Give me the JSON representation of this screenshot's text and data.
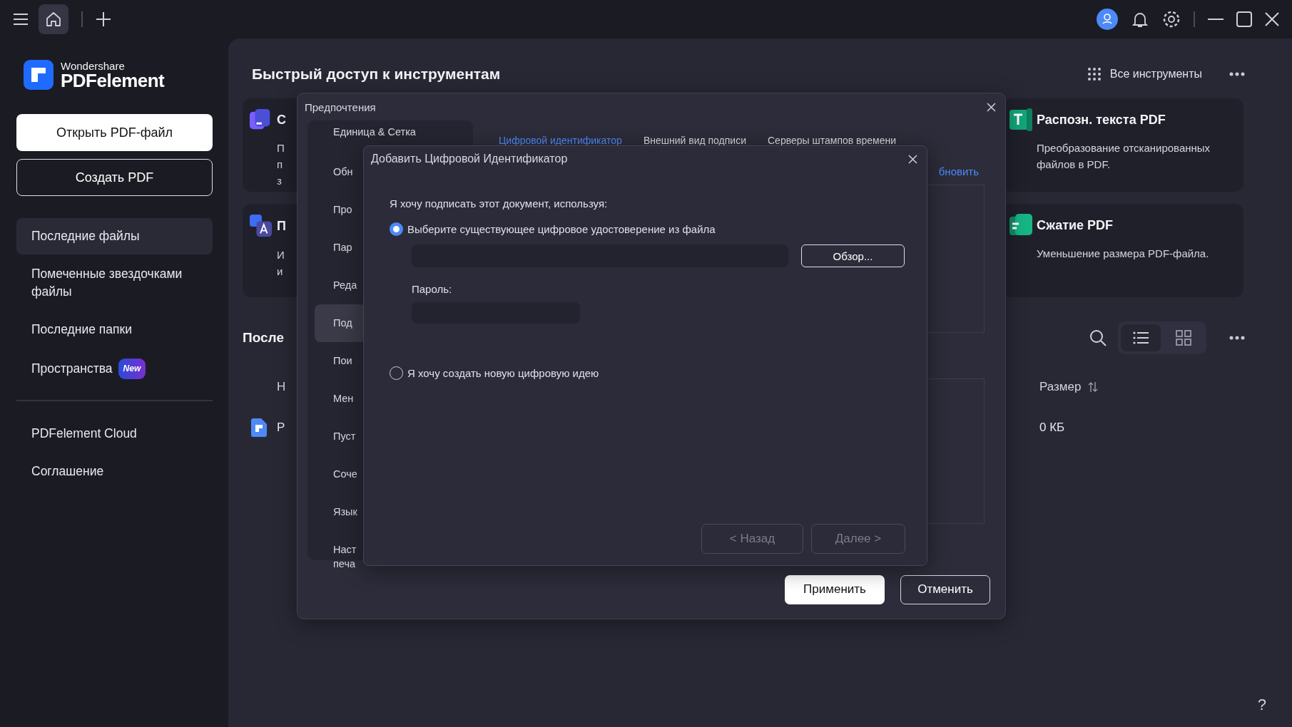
{
  "brand": {
    "vendor": "Wondershare",
    "product": "PDFelement"
  },
  "sidebar": {
    "buttons": [
      {
        "label": "Открыть PDF-файл",
        "kind": "primary"
      },
      {
        "label": "Создать PDF",
        "kind": "outline"
      }
    ],
    "items": [
      {
        "label": "Последние файлы",
        "selected": true
      },
      {
        "label": "Помеченные звездочками файлы",
        "selected": false
      },
      {
        "label": "Последние папки",
        "selected": false
      },
      {
        "label": "Пространства",
        "selected": false,
        "badge": "New"
      }
    ],
    "footer_items": [
      "PDFelement Cloud",
      "Соглашение"
    ]
  },
  "quick_tools": {
    "title": "Быстрый доступ к инструментам",
    "all_tools": "Все инструменты",
    "cards": [
      {
        "kind": "pen",
        "title": "С",
        "description_lines": [
          "П",
          "п",
          "з"
        ]
      },
      {
        "kind": "ocr",
        "title": "Распозн. текста PDF",
        "description_lines": [
          "Преобразование отсканированных",
          "файлов в PDF."
        ]
      },
      {
        "kind": "translate",
        "title": "П",
        "description_lines": [
          "И",
          "и"
        ]
      },
      {
        "kind": "compress",
        "title": "Сжатие PDF",
        "description_lines": [
          "Уменьшение размера PDF-файла."
        ]
      }
    ]
  },
  "recent": {
    "title": "После",
    "columns": [
      "Н",
      "Размер"
    ],
    "rows": [
      {
        "name": "Р",
        "size": "0 КБ"
      }
    ]
  },
  "view_modes": [
    {
      "kind": "list",
      "selected": true
    },
    {
      "kind": "grid",
      "selected": false
    }
  ],
  "help_button": "?",
  "preferences": {
    "title": "Предпочтения",
    "nav": [
      {
        "label": "Единица & Сетка",
        "selected": false
      },
      {
        "label": "Обн",
        "selected": false
      },
      {
        "label": "Про",
        "selected": false
      },
      {
        "label": "Пар",
        "selected": false
      },
      {
        "label": "Реда",
        "selected": false
      },
      {
        "label": "Под",
        "selected": true
      },
      {
        "label": "Пои",
        "selected": false
      },
      {
        "label": "Мен",
        "selected": false
      },
      {
        "label": "Пуст",
        "selected": false
      },
      {
        "label": "Соче",
        "selected": false
      },
      {
        "label": "Язык",
        "selected": false
      },
      {
        "label": "Наст печа",
        "selected": false
      }
    ],
    "tabs": [
      {
        "label": "Цифровой идентификатор",
        "selected": true
      },
      {
        "label": "Внешний вид подписи",
        "selected": false
      },
      {
        "label": "Серверы штампов времени",
        "selected": false
      }
    ],
    "link": "бновить",
    "buttons": [
      {
        "label": "Применить",
        "kind": "primary"
      },
      {
        "label": "Отменить",
        "kind": "outline"
      }
    ]
  },
  "add_id_dialog": {
    "title": "Добавить Цифровой Идентификатор",
    "prompt": "Я хочу подписать этот документ, используя:",
    "options": [
      {
        "label": "Выберите существующее цифровое удостоверение из файла",
        "selected": true
      },
      {
        "label": "Я хочу создать новую цифровую идею",
        "selected": false
      }
    ],
    "browse_button": "Обзор...",
    "password_label": "Пароль:",
    "nav_buttons": [
      {
        "label": "< Назад",
        "disabled": true
      },
      {
        "label": "Далее >",
        "disabled": true
      }
    ]
  }
}
